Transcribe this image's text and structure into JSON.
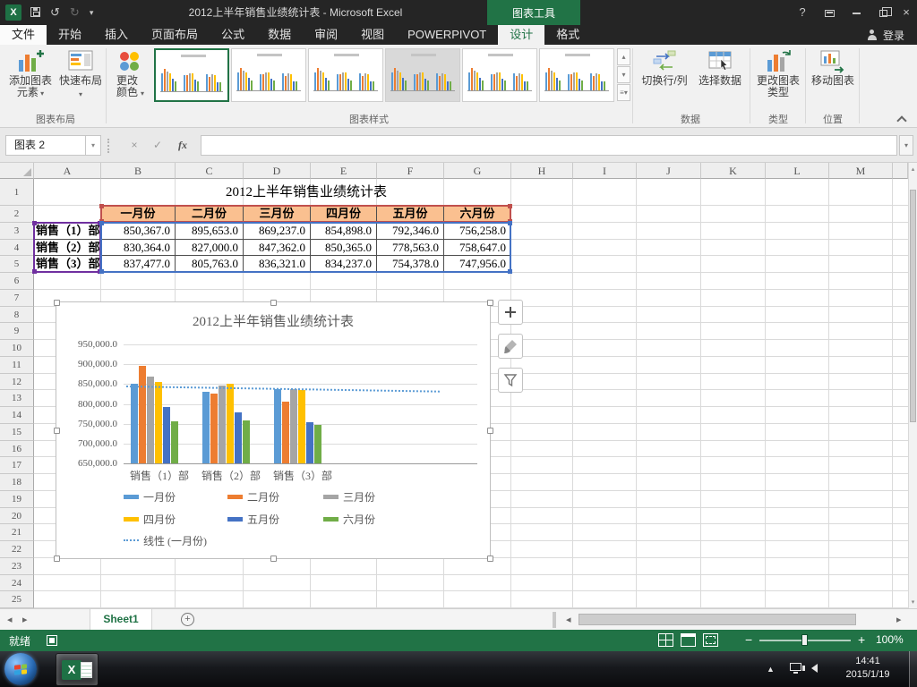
{
  "titlebar": {
    "title": "2012上半年销售业绩统计表 - Microsoft Excel",
    "context_tool": "图表工具"
  },
  "ribbon": {
    "tabs": [
      {
        "label": "文件",
        "kind": "file"
      },
      {
        "label": "开始"
      },
      {
        "label": "插入"
      },
      {
        "label": "页面布局"
      },
      {
        "label": "公式"
      },
      {
        "label": "数据"
      },
      {
        "label": "审阅"
      },
      {
        "label": "视图"
      },
      {
        "label": "POWERPIVOT"
      },
      {
        "label": "设计",
        "selected": true
      },
      {
        "label": "格式"
      }
    ],
    "sign_in": "登录",
    "groups": [
      "图表布局",
      "图表样式",
      "数据",
      "类型",
      "位置"
    ],
    "buttons": {
      "add_chart_element": "添加图表元素",
      "quick_layout": "快速布局",
      "change_colors": "更改颜色",
      "switch_row_col": "切换行/列",
      "select_data": "选择数据",
      "change_chart_type": "更改图表类型",
      "move_chart": "移动图表"
    }
  },
  "formula_bar": {
    "name_box": "图表 2",
    "fx_label": "fx",
    "value": ""
  },
  "sheet": {
    "columns": [
      "A",
      "B",
      "C",
      "D",
      "E",
      "F",
      "G",
      "H",
      "I",
      "J",
      "K",
      "L",
      "M"
    ],
    "row_count": 25,
    "table": {
      "title": "2012上半年销售业绩统计表",
      "header_fill": "#FAC090",
      "months": [
        "一月份",
        "二月份",
        "三月份",
        "四月份",
        "五月份",
        "六月份"
      ],
      "rows": [
        {
          "label": "销售（1）部",
          "values": [
            "850,367.0",
            "895,653.0",
            "869,237.0",
            "854,898.0",
            "792,346.0",
            "756,258.0"
          ]
        },
        {
          "label": "销售（2）部",
          "values": [
            "830,364.0",
            "827,000.0",
            "847,362.0",
            "850,365.0",
            "778,563.0",
            "758,647.0"
          ]
        },
        {
          "label": "销售（3）部",
          "values": [
            "837,477.0",
            "805,763.0",
            "836,321.0",
            "834,237.0",
            "754,378.0",
            "747,956.0"
          ]
        }
      ]
    }
  },
  "chart_data": {
    "type": "bar",
    "title": "2012上半年销售业绩统计表",
    "categories": [
      "销售（1）部",
      "销售（2）部",
      "销售（3）部"
    ],
    "series": [
      {
        "name": "一月份",
        "color": "#5B9BD5",
        "values": [
          850367,
          830364,
          837477
        ]
      },
      {
        "name": "二月份",
        "color": "#ED7D31",
        "values": [
          895653,
          827000,
          805763
        ]
      },
      {
        "name": "三月份",
        "color": "#A5A5A5",
        "values": [
          869237,
          847362,
          836321
        ]
      },
      {
        "name": "四月份",
        "color": "#FFC000",
        "values": [
          854898,
          850365,
          834237
        ]
      },
      {
        "name": "五月份",
        "color": "#4472C4",
        "values": [
          792346,
          778563,
          754378
        ]
      },
      {
        "name": "六月份",
        "color": "#70AD47",
        "values": [
          756258,
          758647,
          747956
        ]
      }
    ],
    "trendline": {
      "name": "线性 (一月份)",
      "series": "一月份",
      "style": "dotted",
      "color": "#5B9BD5",
      "y_start": 845848,
      "y_end": 832958
    },
    "ylim": [
      650000,
      950000
    ],
    "ytick_labels": [
      "950,000.0",
      "900,000.0",
      "850,000.0",
      "800,000.0",
      "750,000.0",
      "700,000.0",
      "650,000.0"
    ],
    "grid": true,
    "legend_position": "bottom"
  },
  "sheet_tabs": {
    "active": "Sheet1"
  },
  "status_bar": {
    "mode": "就绪",
    "zoom": "100%"
  },
  "taskbar": {
    "time": "14:41",
    "date": "2015/1/19"
  }
}
